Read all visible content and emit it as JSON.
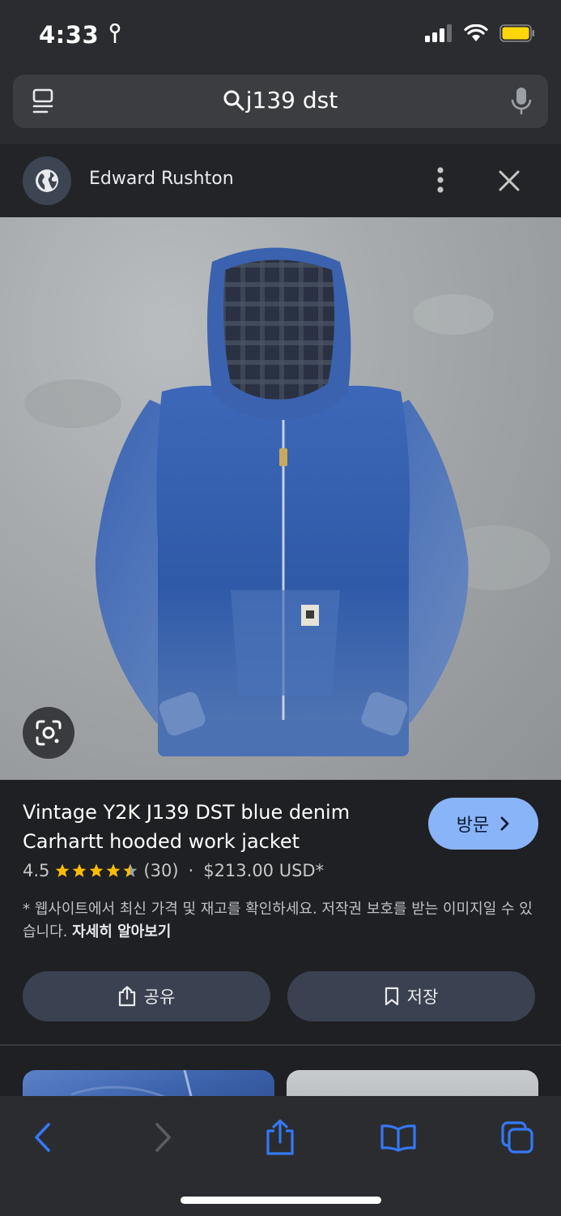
{
  "status_bar": {
    "time": "4:33",
    "location_icon": "location-arrow-icon",
    "signal_icon": "cellular-signal-icon",
    "wifi_icon": "wifi-icon",
    "battery_icon": "battery-icon",
    "battery_color": "#ffd60a"
  },
  "address_bar": {
    "query": "j139 dst",
    "left_icon": "tab-view-icon",
    "search_icon": "search-icon",
    "right_icon": "microphone-icon"
  },
  "source": {
    "name": "Edward Rushton",
    "avatar_icon": "globe-icon",
    "more_icon": "more-vertical-icon",
    "close_icon": "close-icon"
  },
  "hero": {
    "lens_icon": "google-lens-icon"
  },
  "product": {
    "title": "Vintage Y2K J139 DST blue denim Carhartt hooded work jacket",
    "visit_label": "방문",
    "rating": "4.5",
    "rating_value": 4.5,
    "review_count": "(30)",
    "separator": "·",
    "price": "$213.00 USD*",
    "disclaimer": "* 웹사이트에서 최신 가격 및 재고를 확인하세요. 저작권 보호를 받는 이미지일 수 있습니다.",
    "learn_more": "자세히 알아보기",
    "share_label": "공유",
    "save_label": "저장",
    "accent_color": "#8ab4f8",
    "star_color": "#fbbc04"
  },
  "toolbar": {
    "back_icon": "back-chevron-icon",
    "forward_icon": "forward-chevron-icon",
    "share_icon": "share-icon",
    "bookmarks_icon": "bookmarks-book-icon",
    "tabs_icon": "tabs-icon",
    "accent_color": "#3478f6"
  }
}
